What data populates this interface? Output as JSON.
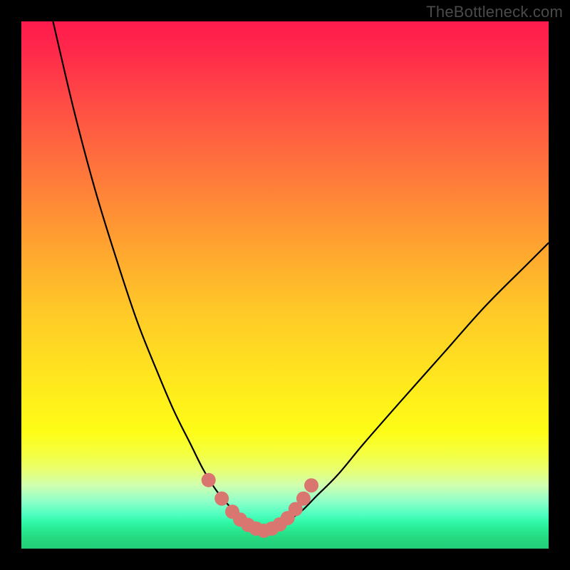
{
  "watermark": "TheBottleneck.com",
  "colors": {
    "page_bg": "#000000",
    "watermark_text": "#4a4a4a",
    "curve_stroke": "#000000",
    "marker_fill": "#d9766f",
    "gradient_stops": [
      "#ff1a4d",
      "#ff4a45",
      "#ff8b36",
      "#ffc928",
      "#fff01a",
      "#d0ffb0",
      "#30f8a8",
      "#22cc78"
    ]
  },
  "chart_data": {
    "type": "line",
    "title": "",
    "xlabel": "",
    "ylabel": "",
    "xlim": [
      0,
      100
    ],
    "ylim": [
      0,
      100
    ],
    "grid": false,
    "legend": null,
    "note": "Bottleneck-style V-curve over a vertical thermal gradient. Axes unlabeled; values are proportional (0–100) estimates read from pixel positions. Lower y = better (green zone at bottom).",
    "series": [
      {
        "name": "left-branch",
        "x": [
          6,
          10,
          14,
          18,
          22,
          26,
          29,
          32,
          34.5,
          37,
          39.5,
          41.5,
          43,
          44.5,
          46
        ],
        "y": [
          100,
          83,
          68,
          55,
          43,
          33,
          26,
          20,
          15,
          11,
          8,
          6,
          5,
          4,
          3.4
        ]
      },
      {
        "name": "right-branch",
        "x": [
          46,
          48,
          50,
          53,
          56,
          60,
          65,
          72,
          80,
          88,
          96,
          100
        ],
        "y": [
          3.4,
          4,
          5,
          7,
          10,
          14,
          20,
          28,
          37,
          46,
          54,
          58
        ]
      },
      {
        "name": "markers",
        "x": [
          35.5,
          38,
          40,
          41.5,
          43,
          44.5,
          46,
          47.5,
          49,
          50.5,
          52,
          53.5,
          55
        ],
        "y": [
          13,
          9.5,
          7,
          5.5,
          4.5,
          3.8,
          3.4,
          3.8,
          4.6,
          5.8,
          7.5,
          9.5,
          12
        ]
      }
    ]
  }
}
